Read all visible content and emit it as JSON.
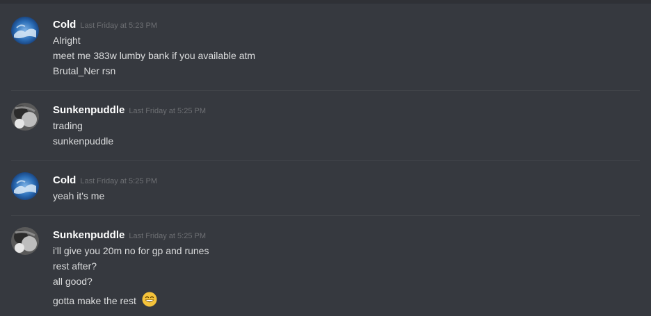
{
  "messages": [
    {
      "author": "Cold",
      "timestamp": "Last Friday at 5:23 PM",
      "avatar": "blue-cloud-avatar",
      "lines": [
        "Alright",
        "meet me 383w lumby bank if you available atm",
        "Brutal_Ner rsn"
      ]
    },
    {
      "author": "Sunkenpuddle",
      "timestamp": "Last Friday at 5:25 PM",
      "avatar": "grayscale-avatar",
      "lines": [
        "trading",
        "sunkenpuddle"
      ]
    },
    {
      "author": "Cold",
      "timestamp": "Last Friday at 5:25 PM",
      "avatar": "blue-cloud-avatar",
      "lines": [
        "yeah it's me"
      ]
    },
    {
      "author": "Sunkenpuddle",
      "timestamp": "Last Friday at 5:25 PM",
      "avatar": "grayscale-avatar",
      "lines": [
        "i'll give you 20m no for gp  and runes",
        "rest after?",
        "all good?",
        "gotta make the rest"
      ],
      "trailing_emoji": "grinning-face-emoji"
    }
  ],
  "colors": {
    "background": "#36393f",
    "username": "#ffffff",
    "timestamp": "#6d6f73",
    "text": "#dcddde",
    "divider": "#42454a"
  }
}
